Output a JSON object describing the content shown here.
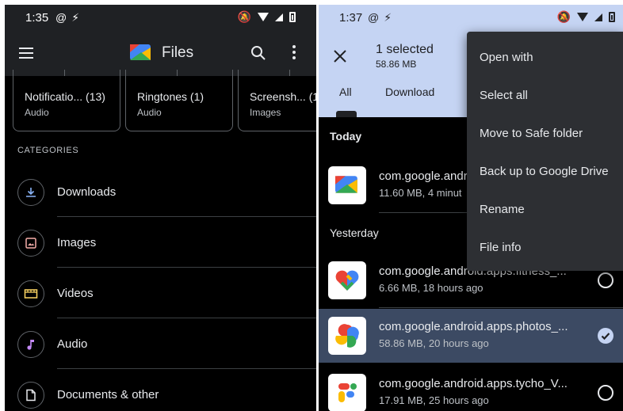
{
  "left": {
    "status": {
      "time": "1:35"
    },
    "appbar": {
      "title": "Files"
    },
    "recent": [
      {
        "title": "Notificatio... (13)",
        "sub": "Audio"
      },
      {
        "title": "Ringtones (1)",
        "sub": "Audio"
      },
      {
        "title": "Screensh... (1",
        "sub": "Images"
      }
    ],
    "categories_label": "CATEGORIES",
    "categories": [
      {
        "name": "Downloads",
        "icon": "download-icon"
      },
      {
        "name": "Images",
        "icon": "image-icon"
      },
      {
        "name": "Videos",
        "icon": "video-icon"
      },
      {
        "name": "Audio",
        "icon": "music-note-icon"
      },
      {
        "name": "Documents & other",
        "icon": "document-icon"
      }
    ]
  },
  "right": {
    "status": {
      "time": "1:37"
    },
    "selection": {
      "count": "1 selected",
      "size": "58.86 MB"
    },
    "chips": [
      "All",
      "Download"
    ],
    "sections": {
      "today": "Today",
      "yesterday": "Yesterday"
    },
    "files": [
      {
        "name": "com.google.andr",
        "meta": "11.60 MB, 4 minut",
        "icon": "files-app-icon",
        "selected": false
      },
      {
        "name": "com.google.android.apps.fitness_...",
        "meta": "6.66 MB, 18 hours ago",
        "icon": "google-fit-icon",
        "selected": false
      },
      {
        "name": "com.google.android.apps.photos_...",
        "meta": "58.86 MB, 20 hours ago",
        "icon": "google-photos-icon",
        "selected": true
      },
      {
        "name": "com.google.android.apps.tycho_V...",
        "meta": "17.91 MB, 25 hours ago",
        "icon": "google-fi-icon",
        "selected": false
      }
    ],
    "menu": [
      "Open with",
      "Select all",
      "Move to Safe folder",
      "Back up to Google Drive",
      "Rename",
      "File info"
    ]
  },
  "colors": {
    "selection_bar": "#c5d4f3",
    "selected_row": "#3c4a63",
    "menu_bg": "#2d2f33",
    "app_bar": "#1f2124"
  }
}
